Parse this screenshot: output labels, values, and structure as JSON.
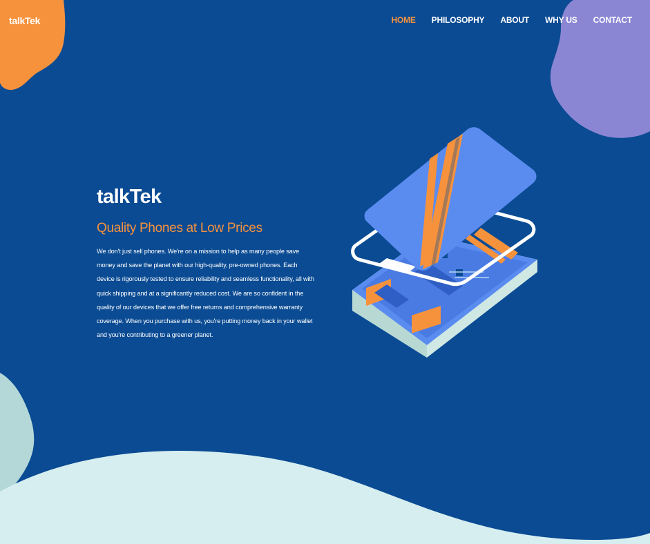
{
  "brand": {
    "logo_text": "talkTek"
  },
  "nav": {
    "items": [
      {
        "label": "HOME",
        "active": true
      },
      {
        "label": "PHILOSOPHY",
        "active": false
      },
      {
        "label": "ABOUT",
        "active": false
      },
      {
        "label": "WHY US",
        "active": false
      },
      {
        "label": "CONTACT",
        "active": false
      }
    ]
  },
  "hero": {
    "title": "talkTek",
    "subtitle": "Quality Phones at Low Prices",
    "body": "We don't just sell phones. We're on a mission to help as many people save money and save the planet with our high-quality, pre-owned phones. Each device is rigorously tested to ensure reliability and seamless functionality, all with quick shipping and at a significantly reduced cost. We are so confident in the quality of our devices that we offer free returns and comprehensive warranty coverage. When you purchase with us, you're putting money back in your wallet and you're contributing to a greener planet."
  },
  "colors": {
    "background": "#0a4b93",
    "accent_orange": "#f7923c",
    "blob_purple": "#8b86d4",
    "blob_teal": "#b4d8d8",
    "wave_light": "#d7eef0",
    "phone_blue": "#5a8cf0"
  },
  "illustration": {
    "icon": "exploded-phone-illustration"
  }
}
